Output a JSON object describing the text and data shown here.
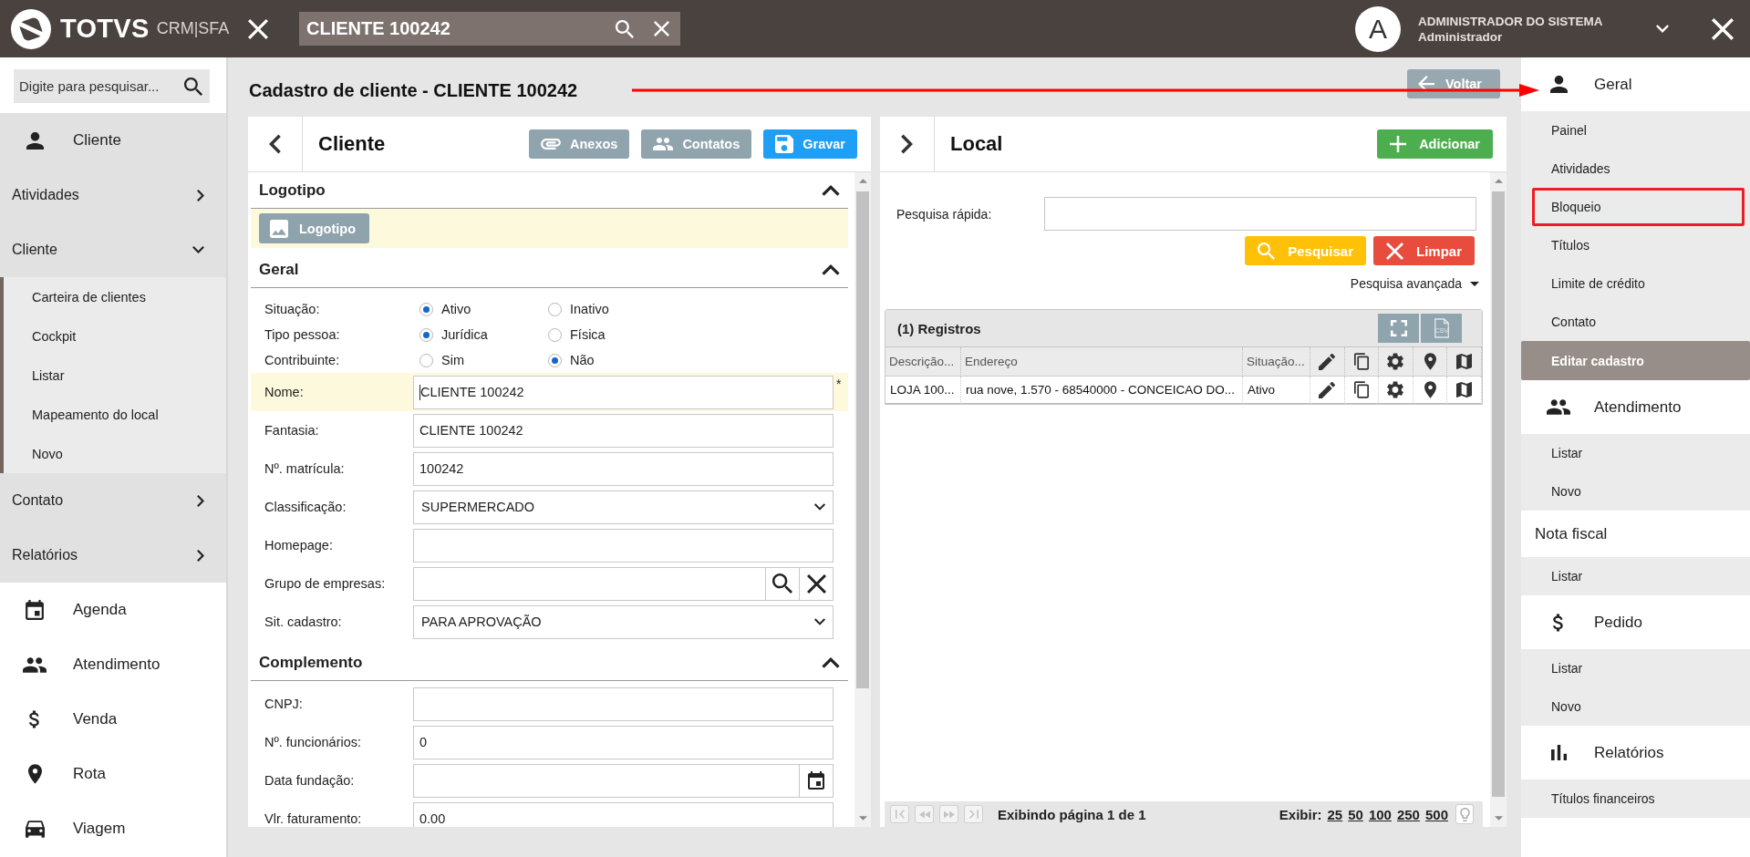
{
  "header": {
    "brand": "TOTVS",
    "product": "CRM|SFA",
    "search": {
      "value": "CLIENTE 100242"
    },
    "user": {
      "initial": "A",
      "name": "ADMINISTRADOR DO SISTEMA",
      "role": "Administrador"
    }
  },
  "left_sidebar": {
    "search": {
      "placeholder": "Digite para pesquisar..."
    },
    "modules": [
      {
        "label": "Cliente",
        "selected": true,
        "groups": [
          {
            "label": "Atividades",
            "expanded": false
          },
          {
            "label": "Cliente",
            "expanded": true,
            "children": [
              {
                "label": "Carteira de clientes"
              },
              {
                "label": "Cockpit"
              },
              {
                "label": "Listar"
              },
              {
                "label": "Mapeamento do local"
              },
              {
                "label": "Novo"
              }
            ]
          },
          {
            "label": "Contato",
            "expanded": false
          },
          {
            "label": "Relatórios",
            "expanded": false
          }
        ]
      },
      {
        "label": "Agenda",
        "selected": false
      },
      {
        "label": "Atendimento",
        "selected": false
      },
      {
        "label": "Venda",
        "selected": false
      },
      {
        "label": "Rota",
        "selected": false
      },
      {
        "label": "Viagem",
        "selected": false
      }
    ]
  },
  "page": {
    "title": "Cadastro de cliente - CLIENTE 100242",
    "back_button": "Voltar"
  },
  "client_panel": {
    "title": "Cliente",
    "buttons": [
      {
        "label": "Anexos",
        "kind": "secondary"
      },
      {
        "label": "Contatos",
        "kind": "secondary"
      },
      {
        "label": "Gravar",
        "kind": "primary"
      }
    ],
    "sections": [
      {
        "title": "Logotipo",
        "expanded": true,
        "button": "Logotipo"
      },
      {
        "title": "Geral",
        "expanded": true,
        "radio_groups": [
          {
            "label": "Situação:",
            "options": [
              {
                "label": "Ativo",
                "selected": true
              },
              {
                "label": "Inativo",
                "selected": false
              }
            ]
          },
          {
            "label": "Tipo pessoa:",
            "options": [
              {
                "label": "Jurídica",
                "selected": true
              },
              {
                "label": "Física",
                "selected": false
              }
            ]
          },
          {
            "label": "Contribuinte:",
            "options": [
              {
                "label": "Sim",
                "selected": false
              },
              {
                "label": "Não",
                "selected": true
              }
            ]
          }
        ],
        "fields": [
          {
            "label": "Nome:",
            "kind": "text",
            "value": "CLIENTE 100242",
            "focused": true,
            "required_mark": "*"
          },
          {
            "label": "Fantasia:",
            "kind": "text",
            "value": "CLIENTE 100242",
            "focused": false
          },
          {
            "label": "Nº. matrícula:",
            "kind": "text",
            "value": "100242",
            "focused": false
          },
          {
            "label": "Classificação:",
            "kind": "select",
            "value": "SUPERMERCADO",
            "focused": false
          },
          {
            "label": "Homepage:",
            "kind": "text",
            "focused": false
          },
          {
            "label": "Grupo de empresas:",
            "kind": "lookup",
            "focused": false
          },
          {
            "label": "Sit. cadastro:",
            "kind": "select",
            "value": "PARA APROVAÇÃO",
            "focused": false
          }
        ]
      },
      {
        "title": "Complemento",
        "expanded": true,
        "fields": [
          {
            "label": "CNPJ:",
            "kind": "text",
            "focused": false
          },
          {
            "label": "Nº. funcionários:",
            "kind": "text",
            "value": "0",
            "focused": false
          },
          {
            "label": "Data fundação:",
            "kind": "date",
            "focused": false
          },
          {
            "label": "Vlr. faturamento:",
            "kind": "text",
            "value": "0.00",
            "focused": false
          }
        ]
      }
    ]
  },
  "local_panel": {
    "title": "Local",
    "add_button": "Adicionar",
    "quick_search": {
      "label": "Pesquisa rápida:"
    },
    "search_button": "Pesquisar",
    "clear_button": "Limpar",
    "advanced_search": "Pesquisa avançada",
    "grid": {
      "title": "(1) Registros",
      "export_label": "CSV",
      "columns": [
        "Descrição...",
        "Endereço",
        "Situação..."
      ],
      "rows": [
        [
          "LOJA 100...",
          "rua nove, 1.570 - 68540000 - CONCEICAO DO...",
          "Ativo"
        ]
      ]
    },
    "pager": {
      "status": "Exibindo página 1 de 1",
      "page_size_label": "Exibir:",
      "page_sizes": [
        "25",
        "50",
        "100",
        "250",
        "500"
      ]
    }
  },
  "right_sidebar": {
    "sections": [
      {
        "label": "Geral",
        "items": [
          {
            "label": "Painel",
            "selected": false,
            "highlighted": false
          },
          {
            "label": "Atividades",
            "selected": false,
            "highlighted": false
          },
          {
            "label": "Bloqueio",
            "selected": false,
            "highlighted": true
          },
          {
            "label": "Títulos",
            "selected": false,
            "highlighted": false
          },
          {
            "label": "Limite de crédito",
            "selected": false,
            "highlighted": false
          },
          {
            "label": "Contato",
            "selected": false,
            "highlighted": false
          },
          {
            "label": "Editar cadastro",
            "selected": true,
            "highlighted": false
          }
        ]
      },
      {
        "label": "Atendimento",
        "items": [
          {
            "label": "Listar",
            "selected": false,
            "highlighted": false
          },
          {
            "label": "Novo",
            "selected": false,
            "highlighted": false
          }
        ]
      },
      {
        "label": "Nota fiscal",
        "items": [
          {
            "label": "Listar",
            "selected": false,
            "highlighted": false
          }
        ]
      },
      {
        "label": "Pedido",
        "items": [
          {
            "label": "Listar",
            "selected": false,
            "highlighted": false
          },
          {
            "label": "Novo",
            "selected": false,
            "highlighted": false
          }
        ]
      },
      {
        "label": "Relatórios",
        "items": [
          {
            "label": "Títulos financeiros",
            "selected": false,
            "highlighted": false
          }
        ]
      }
    ]
  }
}
